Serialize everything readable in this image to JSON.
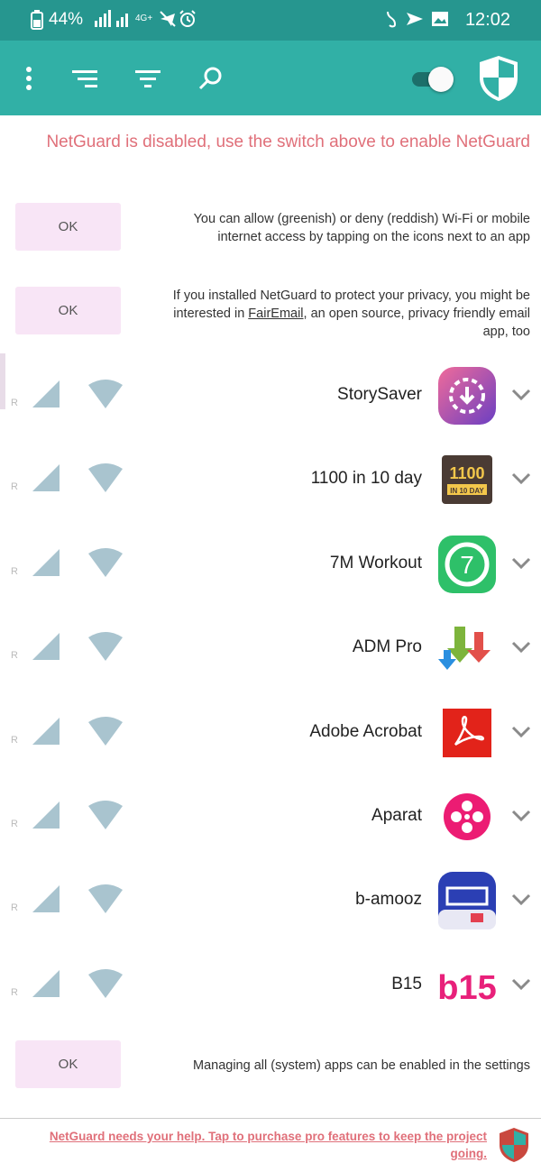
{
  "status_bar": {
    "time": "12:02",
    "battery": "44%",
    "network_label": "4G+"
  },
  "toolbar": {
    "menu_icon": "more-vert-icon",
    "sort_icon": "sort-icon",
    "filter_icon": "filter-icon",
    "search_icon": "search-icon",
    "enabled": false,
    "logo_icon": "netguard-shield-icon"
  },
  "disabled_message": "NetGuard is disabled, use the switch above to enable NetGuard",
  "hints": [
    {
      "text": "You can allow (greenish) or deny (reddish) Wi-Fi or mobile internet access by tapping on the icons next to an app",
      "button": "OK"
    },
    {
      "text_before": "If you installed NetGuard to protect your privacy, you might be interested in ",
      "link": "FairEmail",
      "text_after": ", an open source, privacy friendly email app, too",
      "button": "OK"
    }
  ],
  "apps": [
    {
      "name": "StorySaver",
      "icon": "storysaver-icon",
      "r_label": "R"
    },
    {
      "name": "1100 in 10 day",
      "icon": "1100-in-10-day-icon",
      "icon_text_1": "1100",
      "icon_text_2": "IN 10 DAY",
      "r_label": "R"
    },
    {
      "name": "7M Workout",
      "icon": "7m-workout-icon",
      "icon_text": "7",
      "r_label": "R"
    },
    {
      "name": "ADM Pro",
      "icon": "adm-pro-icon",
      "r_label": "R"
    },
    {
      "name": "Adobe Acrobat",
      "icon": "adobe-acrobat-icon",
      "r_label": "R"
    },
    {
      "name": "Aparat",
      "icon": "aparat-icon",
      "r_label": "R"
    },
    {
      "name": "b-amooz",
      "icon": "b-amooz-icon",
      "r_label": "R"
    },
    {
      "name": "B15",
      "icon": "b15-icon",
      "icon_text": "b15",
      "r_label": "R"
    }
  ],
  "system_hint": {
    "text": "Managing all (system) apps can be enabled in the settings",
    "button": "OK"
  },
  "footer": {
    "text": "NetGuard needs your help. Tap to purchase pro features to keep the project going."
  },
  "colors": {
    "status_bar": "#26968f",
    "toolbar": "#31b0a6",
    "warning_text": "#e0707a",
    "ok_button_bg": "#f8e5f6",
    "wifi_icon": "#a9c4cf"
  }
}
